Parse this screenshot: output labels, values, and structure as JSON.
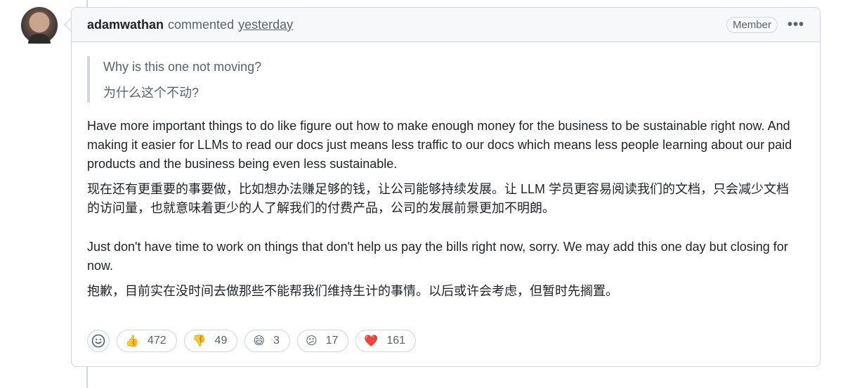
{
  "comment": {
    "author": "adamwathan",
    "action": "commented",
    "time": "yesterday",
    "badge": "Member",
    "more_label": "•••",
    "quote": {
      "en": "Why is this one not moving?",
      "zh": "为什么这个不动?"
    },
    "paragraphs": [
      "Have more important things to do like figure out how to make enough money for the business to be sustainable right now. And making it easier for LLMs to read our docs just means less traffic to our docs which means less people learning about our paid products and the business being even less sustainable.",
      "现在还有更重要的事要做，比如想办法赚足够的钱，让公司能够持续发展。让 LLM 学员更容易阅读我们的文档，只会减少文档的访问量，也就意味着更少的人了解我们的付费产品，公司的发展前景更加不明朗。",
      "Just don't have time to work on things that don't help us pay the bills right now, sorry. We may add this one day but closing for now.",
      "抱歉，目前实在没时间去做那些不能帮我们维持生计的事情。以后或许会考虑，但暂时先搁置。"
    ],
    "reactions": [
      {
        "icon": "thumbs-up-icon",
        "emoji": "👍",
        "count": "472"
      },
      {
        "icon": "thumbs-down-icon",
        "emoji": "👎",
        "count": "49"
      },
      {
        "icon": "laugh-icon",
        "emoji": "😄",
        "count": "3"
      },
      {
        "icon": "confused-icon",
        "emoji": "😕",
        "count": "17"
      },
      {
        "icon": "heart-icon",
        "emoji": "❤️",
        "count": "161"
      }
    ]
  }
}
